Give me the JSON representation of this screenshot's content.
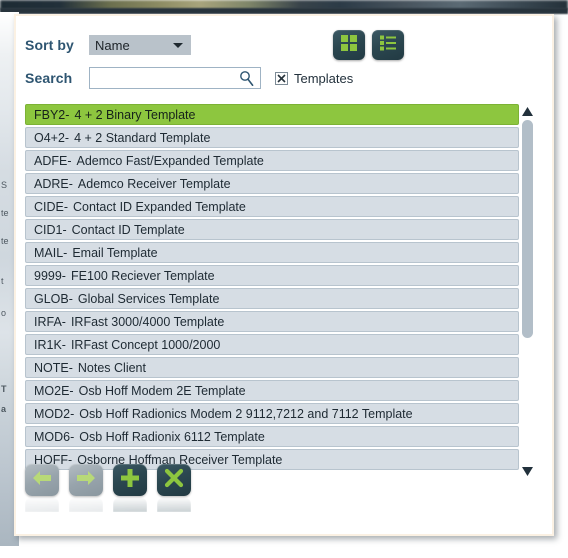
{
  "toolbar": {
    "sort_label": "Sort by",
    "sort_value": "Name",
    "sort_options": [
      "Name"
    ],
    "search_label": "Search",
    "search_value": "",
    "search_placeholder": "",
    "templates_label": "Templates",
    "templates_checked": true,
    "grid_view_icon": "grid-view-icon",
    "list_view_icon": "list-view-icon",
    "search_icon": "search-magnifier-icon"
  },
  "colors": {
    "accent_green": "#8dc63f",
    "dark_slate": "#2b4750",
    "row_bg": "#d6dde4",
    "label_blue": "#2e5571",
    "panel_border": "#fbf1e3"
  },
  "list": {
    "selected_index": 0,
    "rows": [
      {
        "code": "FBY2-",
        "name": "4 + 2 Binary Template"
      },
      {
        "code": "O4+2-",
        "name": "4 + 2 Standard Template"
      },
      {
        "code": "ADFE-",
        "name": "Ademco Fast/Expanded Template"
      },
      {
        "code": "ADRE-",
        "name": "Ademco Receiver Template"
      },
      {
        "code": "CIDE-",
        "name": "Contact ID Expanded Template"
      },
      {
        "code": "CID1-",
        "name": "Contact ID Template"
      },
      {
        "code": "MAIL-",
        "name": "Email Template"
      },
      {
        "code": "9999-",
        "name": "FE100 Reciever Template"
      },
      {
        "code": "GLOB-",
        "name": "Global Services Template"
      },
      {
        "code": "IRFA-",
        "name": "IRFast 3000/4000 Template"
      },
      {
        "code": "IR1K-",
        "name": "IRFast Concept 1000/2000"
      },
      {
        "code": "NOTE-",
        "name": "Notes Client"
      },
      {
        "code": "MO2E-",
        "name": "Osb Hoff Modem 2E Template"
      },
      {
        "code": "MOD2-",
        "name": "Osb Hoff Radionics Modem 2 9112,7212 and 7112 Template"
      },
      {
        "code": "MOD6-",
        "name": "Osb Hoff Radionix 6112 Template"
      },
      {
        "code": "HOFF-",
        "name": "Osborne Hoffman Receiver Template"
      }
    ]
  },
  "scrollbar": {
    "up_arrow_icon": "scroll-up-arrow-icon",
    "down_arrow_icon": "scroll-down-arrow-icon"
  },
  "actions": [
    {
      "name": "back-button",
      "icon": "arrow-left-icon",
      "style": "gray",
      "enabled": false
    },
    {
      "name": "forward-button",
      "icon": "arrow-right-icon",
      "style": "gray",
      "enabled": false
    },
    {
      "name": "add-button",
      "icon": "plus-icon",
      "style": "dark",
      "enabled": true
    },
    {
      "name": "delete-button",
      "icon": "close-x-icon",
      "style": "dark",
      "enabled": true
    }
  ],
  "background_fragments": [
    "S",
    "te",
    "te",
    "t",
    "o",
    "T",
    "a"
  ]
}
